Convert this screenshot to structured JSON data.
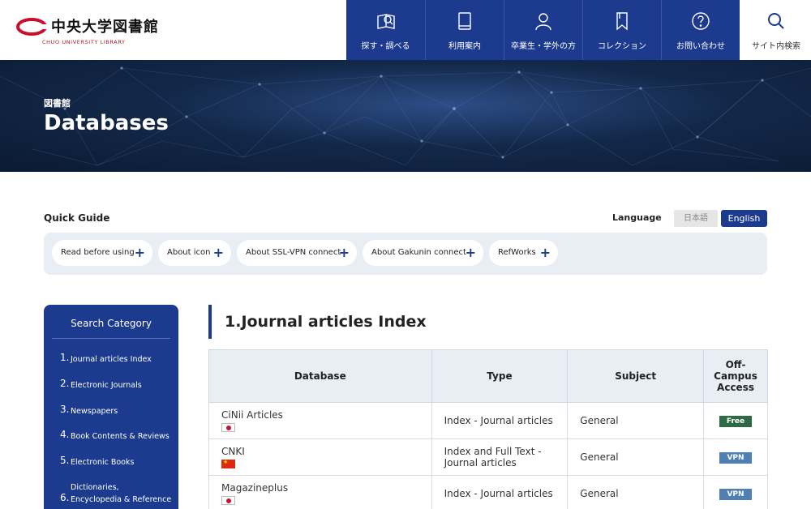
{
  "header": {
    "logo_jp": "中央大学図書館",
    "logo_en": "CHUO UNIVERSITY LIBRARY",
    "nav": [
      {
        "label": "探す・調べる",
        "icon": "search-book-icon"
      },
      {
        "label": "利用案内",
        "icon": "book-icon"
      },
      {
        "label": "卒業生・学外の方",
        "icon": "person-icon"
      },
      {
        "label": "コレクション",
        "icon": "bookmark-icon"
      },
      {
        "label": "お問い合わせ",
        "icon": "question-icon"
      }
    ],
    "search_label": "サイト内検索"
  },
  "hero": {
    "subtitle": "図書館",
    "title": "Databases"
  },
  "quick_guide": {
    "title": "Quick Guide",
    "language_label": "Language",
    "lang_jp": "日本語",
    "lang_en": "English",
    "items": [
      "Read before using",
      "About icon",
      "About SSL-VPN connect",
      "About Gakunin connect",
      "RefWorks"
    ]
  },
  "sidebar": {
    "title": "Search Category",
    "items": [
      {
        "num": "1.",
        "label": "Journal articles Index"
      },
      {
        "num": "2.",
        "label": "Electronic Journals"
      },
      {
        "num": "3.",
        "label": "Newspapers"
      },
      {
        "num": "4.",
        "label": "Book Contents & Reviews"
      },
      {
        "num": "5.",
        "label": "Electronic Books"
      },
      {
        "num": "6.",
        "label": "Dictionaries, Encyclopedia & Reference"
      }
    ]
  },
  "main": {
    "section_title": "1.Journal articles Index",
    "headers": [
      "Database",
      "Type",
      "Subject",
      "Off-Campus Access"
    ],
    "rows": [
      {
        "name": "CiNii Articles",
        "flag": "japan-flag-icon",
        "type": "Index - Journal articles",
        "subject": "General",
        "access": "Free",
        "access_color": "#2e6b45"
      },
      {
        "name": "CNKI",
        "flag": "china-flag-icon",
        "type": "Index and Full Text - Journal articles",
        "subject": "General",
        "access": "VPN",
        "access_color": "#4f7fb5"
      },
      {
        "name": "Magazineplus",
        "flag": "japan-flag-icon",
        "type": "Index - Journal articles",
        "subject": "General",
        "access": "VPN",
        "access_color": "#4f7fb5"
      }
    ]
  }
}
